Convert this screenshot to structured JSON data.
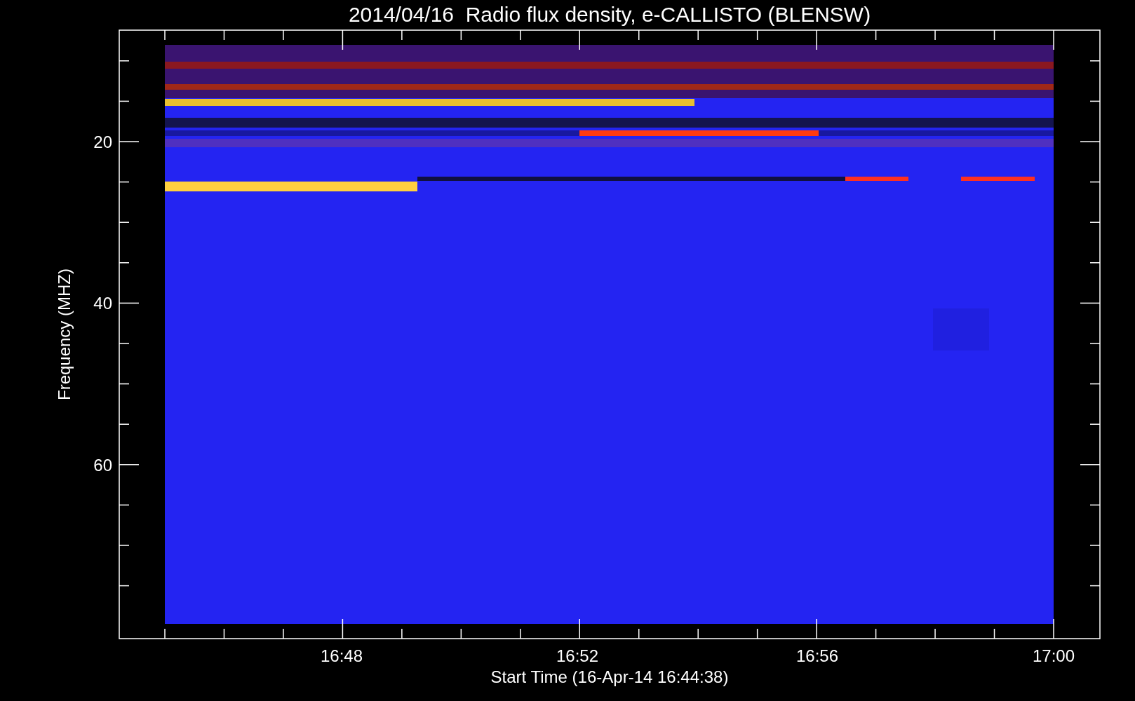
{
  "title": "2014/04/16  Radio flux density, e-CALLISTO (BLENSW)",
  "y_axis": {
    "label": "Frequency (MHZ)",
    "tick_labels": [
      "20",
      "40",
      "60"
    ]
  },
  "x_axis": {
    "label": "Start Time (16-Apr-14 16:44:38)",
    "tick_labels": [
      "16:48",
      "16:52",
      "16:56",
      "17:00"
    ]
  }
}
